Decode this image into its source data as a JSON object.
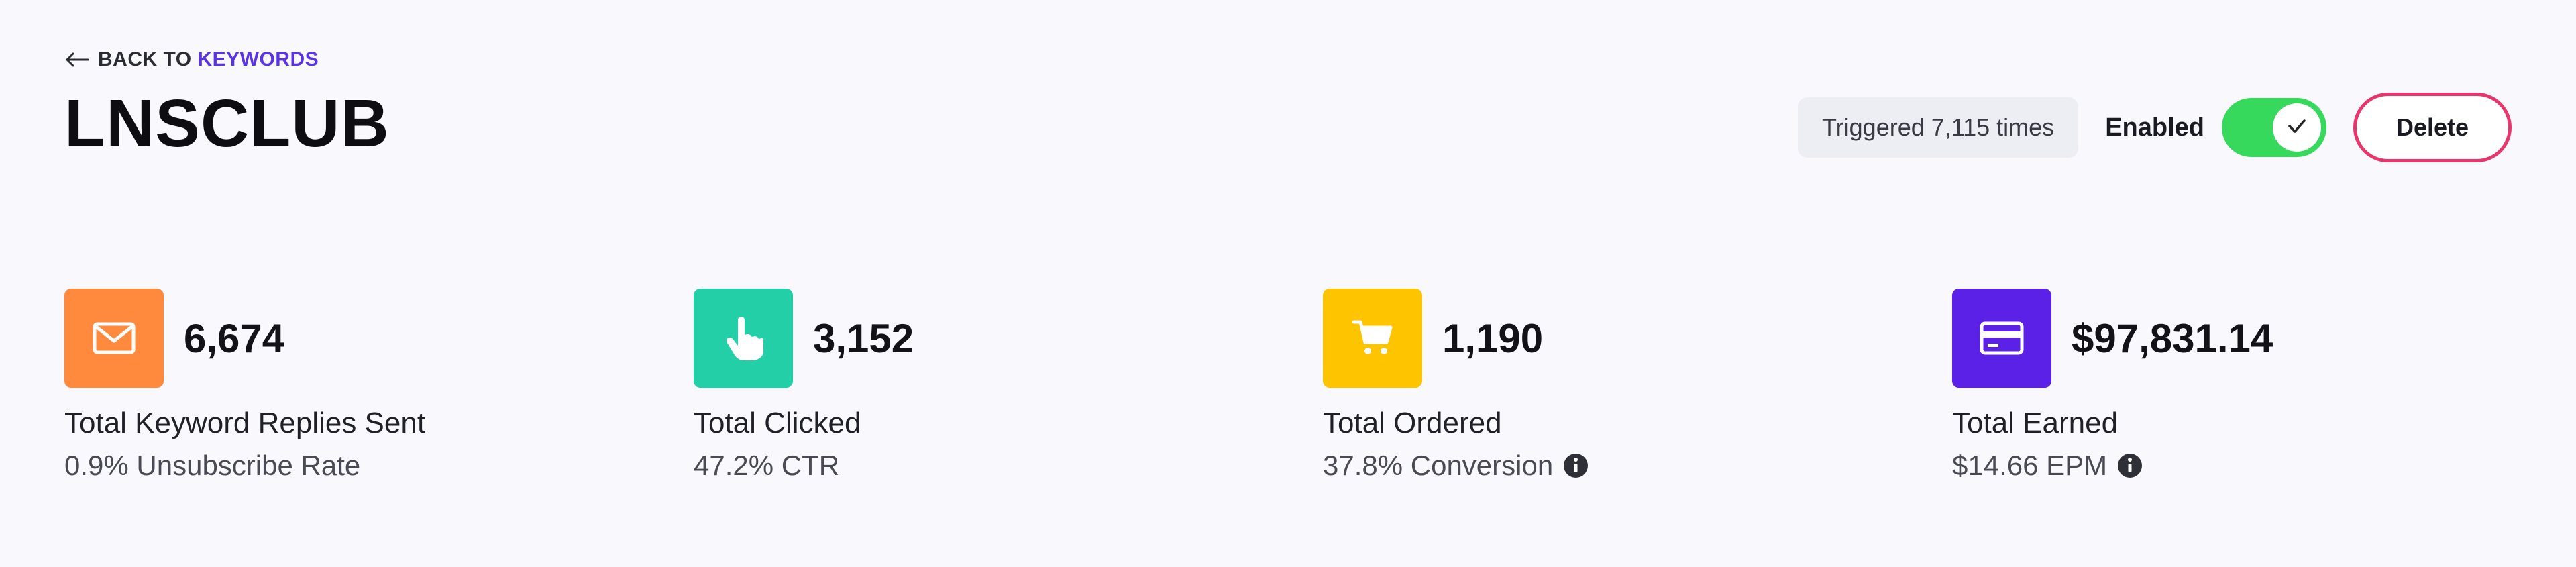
{
  "back": {
    "prefix": "BACK TO ",
    "link": "KEYWORDS"
  },
  "title": "LNSCLUB",
  "triggered": "Triggered 7,115 times",
  "enabled_label": "Enabled",
  "toggle_on": true,
  "delete_label": "Delete",
  "colors": {
    "accent": "#5b33e6",
    "toggle": "#37d95c",
    "delete_border": "#e8356b",
    "orange": "#ff8a3d",
    "teal": "#22cfa6",
    "yellow": "#ffc400",
    "purple": "#5b21e6"
  },
  "stats": [
    {
      "icon": "mail-icon",
      "value": "6,674",
      "label": "Total Keyword Replies Sent",
      "sub": "0.9% Unsubscribe Rate",
      "info": false
    },
    {
      "icon": "pointer-hand-icon",
      "value": "3,152",
      "label": "Total Clicked",
      "sub": "47.2% CTR",
      "info": false
    },
    {
      "icon": "cart-icon",
      "value": "1,190",
      "label": "Total Ordered",
      "sub": "37.8% Conversion",
      "info": true
    },
    {
      "icon": "credit-card-icon",
      "value": "$97,831.14",
      "label": "Total Earned",
      "sub": "$14.66 EPM",
      "info": true
    }
  ]
}
